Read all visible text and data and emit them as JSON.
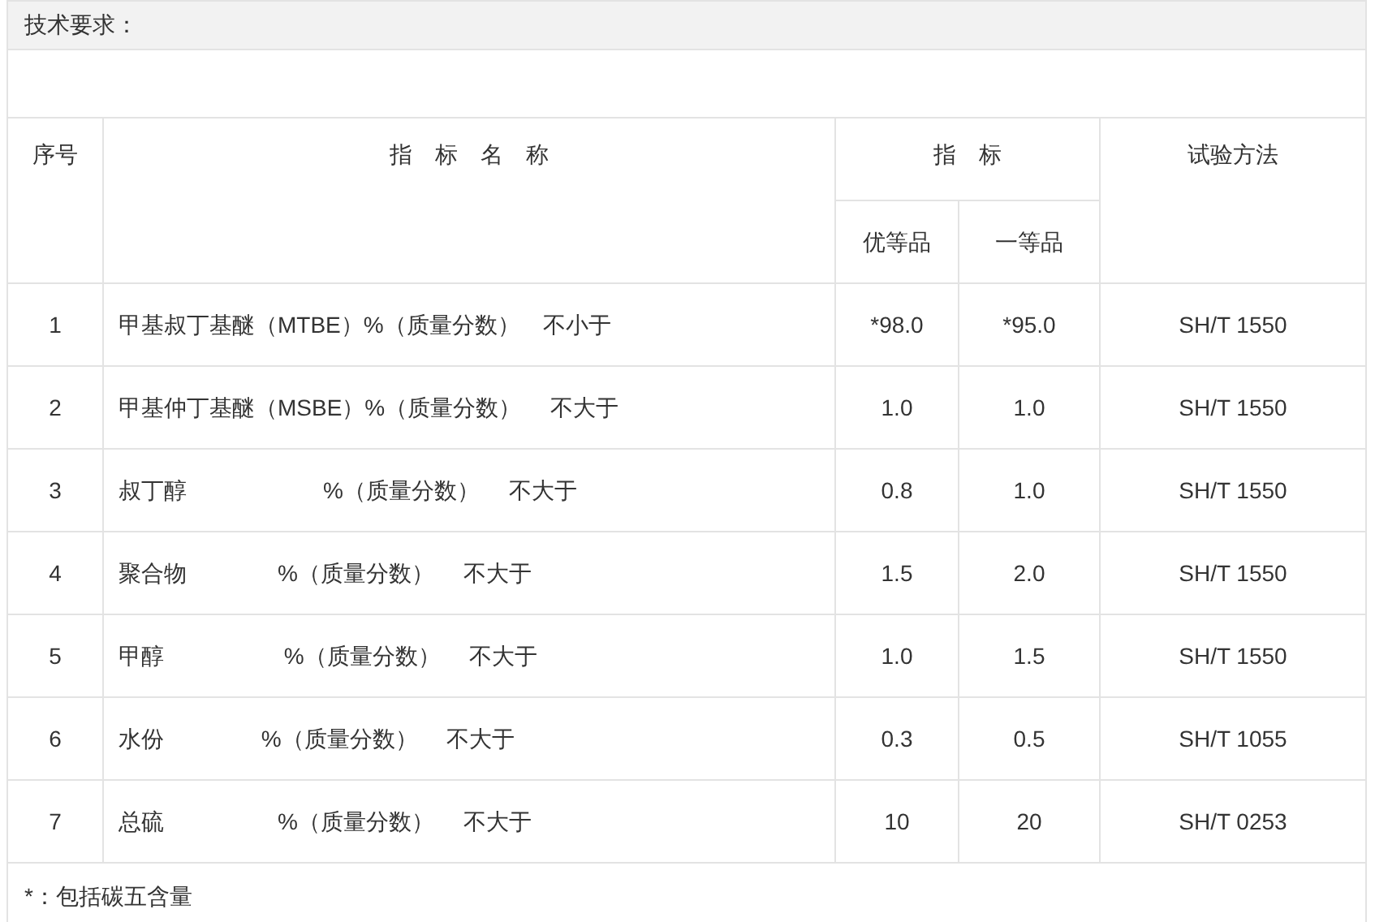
{
  "section_title": "技术要求：",
  "table": {
    "columns": {
      "index": "序号",
      "name": "指　标　名　称",
      "spec": "指　标",
      "grades": [
        "优等品",
        "一等品"
      ],
      "method": "试验方法"
    },
    "rows": [
      {
        "index": "1",
        "name": "甲基叔丁基醚（MTBE）%（质量分数）　不小于",
        "grade_1": "*98.0",
        "grade_2": "*95.0",
        "method": "SH/T 1550"
      },
      {
        "index": "2",
        "name": "甲基仲丁基醚（MSBE）%（质量分数）　 不大于",
        "grade_1": "1.0",
        "grade_2": "1.0",
        "method": "SH/T 1550"
      },
      {
        "index": "3",
        "name": "叔丁醇　　　　　　%（质量分数）　 不大于",
        "grade_1": "0.8",
        "grade_2": "1.0",
        "method": "SH/T 1550"
      },
      {
        "index": "4",
        "name": "聚合物　　　　%（质量分数）　 不大于",
        "grade_1": "1.5",
        "grade_2": "2.0",
        "method": "SH/T 1550"
      },
      {
        "index": "5",
        "name": "甲醇　　　　　 %（质量分数）　 不大于",
        "grade_1": "1.0",
        "grade_2": "1.5",
        "method": "SH/T 1550"
      },
      {
        "index": "6",
        "name": "水份　　　　 %（质量分数）　 不大于",
        "grade_1": "0.3",
        "grade_2": "0.5",
        "method": "SH/T 1055"
      },
      {
        "index": "7",
        "name": "总硫　　　　　%（质量分数）　 不大于",
        "grade_1": "10",
        "grade_2": "20",
        "method": "SH/T 0253"
      }
    ]
  },
  "footnote": "*：包括碳五含量"
}
